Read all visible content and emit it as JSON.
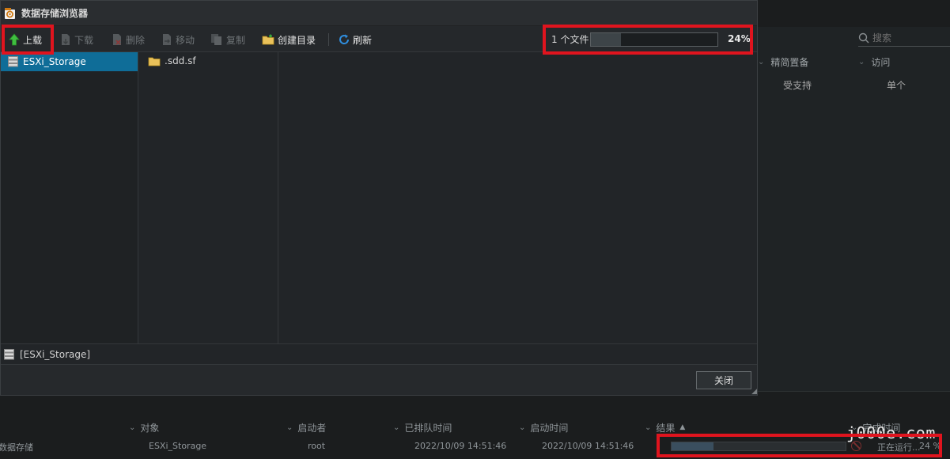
{
  "dialog": {
    "title": "数据存储浏览器",
    "toolbar": {
      "upload": "上载",
      "download": "下载",
      "delete": "删除",
      "move": "移动",
      "copy": "复制",
      "create_dir": "创建目录",
      "refresh": "刷新"
    },
    "upload_status": {
      "file_count": "1 个文件",
      "progress_text": "24%",
      "progress": 0.24
    },
    "tree": {
      "selected": "ESXi_Storage"
    },
    "files": [
      ".sdd.sf"
    ],
    "current_path": "[ESXi_Storage]",
    "close_button": "关闭"
  },
  "background": {
    "search_placeholder": "搜索",
    "columns": [
      "精简置备",
      "访问"
    ],
    "row": [
      "受支持",
      "单个"
    ]
  },
  "tasks": {
    "headers": {
      "object": "对象",
      "initiator": "启动者",
      "queued_time": "已排队时间",
      "start_time": "启动时间",
      "result": "结果",
      "result_sort": "▲",
      "completion_time": "完成时间"
    },
    "row": {
      "name": "数据存储",
      "object": "ESXi_Storage",
      "initiator": "root",
      "queued_time": "2022/10/09 14:51:46",
      "start_time": "2022/10/09 14:51:46",
      "status": "正在运行...",
      "percent": "24 %",
      "progress": 0.24
    }
  },
  "watermark": "j000e.com",
  "colors": {
    "selection": "#0f6d98",
    "highlight_border": "#e0141e",
    "upload_arrow": "#3fbf3f",
    "refresh_icon": "#2f8fe0",
    "folder": "#e9c15a"
  },
  "icons": {
    "app": "datastore-browser-icon",
    "upload": "upload-arrow-icon",
    "download": "download-icon",
    "delete": "delete-icon",
    "move": "move-icon",
    "copy": "copy-icon",
    "create_dir": "new-folder-icon",
    "refresh": "refresh-icon",
    "datastore": "datastore-icon",
    "folder": "folder-icon"
  }
}
